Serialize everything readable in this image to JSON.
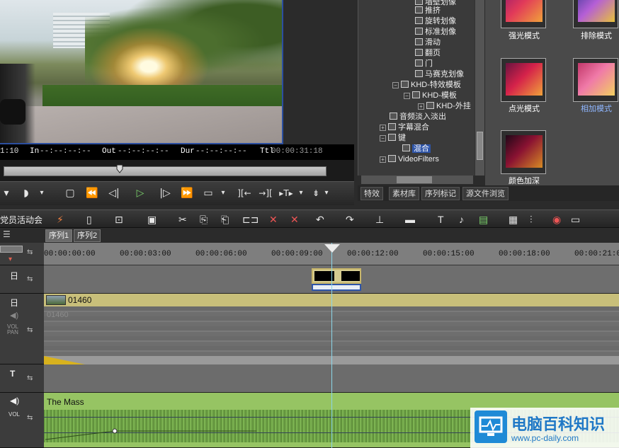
{
  "preview": {
    "timecode": {
      "current": "1:10",
      "in_label": "In",
      "in_value": "--:--:--:--",
      "out_label": "Out",
      "out_value": "--:--:--:--",
      "dur_label": "Dur",
      "dur_value": "--:--:--:--",
      "ttl_label": "Ttl",
      "ttl_value": "00:00:31:18"
    },
    "scrub_position": 0.36
  },
  "effects_tree": {
    "items": [
      {
        "label": "墙壁划像",
        "level": 3
      },
      {
        "label": "推挤",
        "level": 3
      },
      {
        "label": "旋转划像",
        "level": 3
      },
      {
        "label": "标准划像",
        "level": 3
      },
      {
        "label": "滑动",
        "level": 3
      },
      {
        "label": "翻页",
        "level": 3
      },
      {
        "label": "门",
        "level": 3
      },
      {
        "label": "马赛克划像",
        "level": 3
      },
      {
        "label": "KHD-特效模板",
        "level": 2
      },
      {
        "label": "KHD-模板",
        "level": 3
      },
      {
        "label": "KHD-外挂",
        "level": 4
      },
      {
        "label": "音频淡入淡出",
        "level": 1
      },
      {
        "label": "字幕混合",
        "level": 1
      },
      {
        "label": "键",
        "level": 1
      },
      {
        "label": "混合",
        "level": 2,
        "selected": true
      },
      {
        "label": "VideoFilters",
        "level": 1
      }
    ]
  },
  "bins": {
    "tabs": [
      "特效",
      "素材库",
      "序列标记",
      "源文件浏览"
    ]
  },
  "effects_grid": {
    "items": [
      {
        "label": "强光模式"
      },
      {
        "label": "排除模式"
      },
      {
        "label": "点光模式"
      },
      {
        "label": "相加模式",
        "highlight": true
      },
      {
        "label": "颜色加深"
      }
    ]
  },
  "panel_label": "党员活动会",
  "sequence_tabs": [
    "序列1",
    "序列2"
  ],
  "ruler": {
    "ticks": [
      "00:00:00:00",
      "00:00:03:00",
      "00:00:06:00",
      "00:00:09:00",
      "00:00:12:00",
      "00:00:15:00",
      "00:00:18:00",
      "00:00:21:0"
    ]
  },
  "tracks": {
    "video_clip_name": "01460",
    "audio_under_clip": "01460",
    "audio_clip_name": "The Mass",
    "vol_label": "VOL",
    "pan_label": "PAN",
    "title_label": "T"
  },
  "watermark": {
    "title": "电脑百科知识",
    "url": "www.pc-daily.com"
  },
  "colors": {
    "video_track": "#c8bf7a",
    "audio_track": "#96c463",
    "playhead": "#8cd6e8",
    "selection": "#2f55a8"
  }
}
